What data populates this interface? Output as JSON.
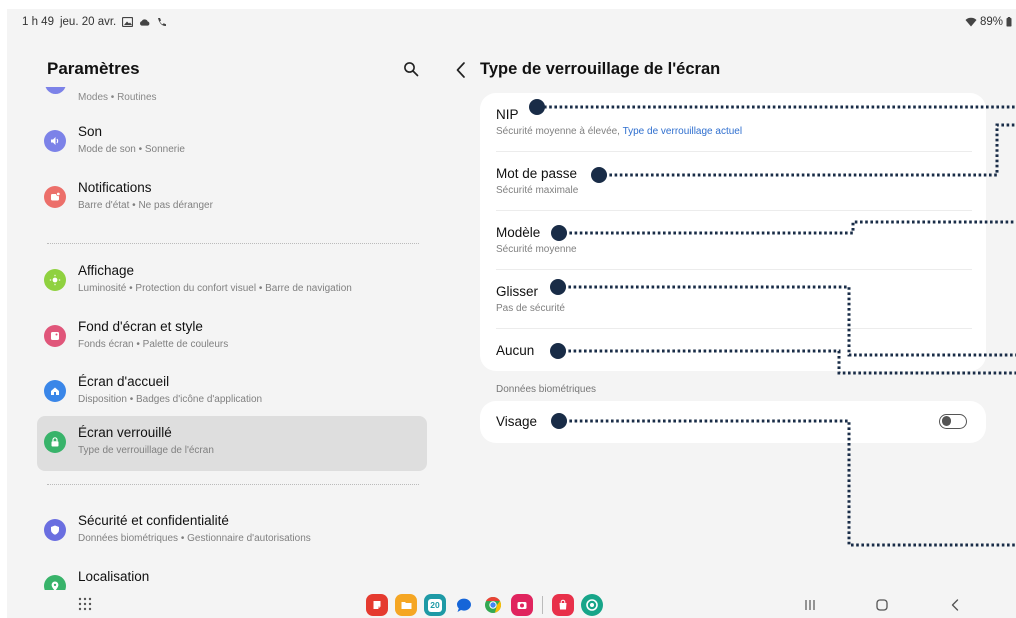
{
  "status_bar": {
    "time": "1 h 49",
    "date": "jeu. 20 avr.",
    "battery": "89%"
  },
  "left_panel": {
    "title": "Paramètres",
    "cut_item_subtitle": "Modes • Routines",
    "items": [
      {
        "title": "Son",
        "subtitle": "Mode de son • Sonnerie",
        "icon": "sound-icon",
        "color": "#7c82e8"
      },
      {
        "title": "Notifications",
        "subtitle": "Barre d'état • Ne pas déranger",
        "icon": "notification-icon",
        "color": "#ec6f6a"
      },
      {
        "title": "Affichage",
        "subtitle": "Luminosité • Protection du confort visuel • Barre de navigation",
        "icon": "display-icon",
        "color": "#8fd13f"
      },
      {
        "title": "Fond d'écran et style",
        "subtitle": "Fonds écran • Palette de couleurs",
        "icon": "wallpaper-icon",
        "color": "#e0567a"
      },
      {
        "title": "Écran d'accueil",
        "subtitle": "Disposition • Badges d'icône d'application",
        "icon": "home-screen-icon",
        "color": "#3a86e8"
      },
      {
        "title": "Écran verrouillé",
        "subtitle": "Type de verrouillage de l'écran",
        "icon": "lock-icon",
        "color": "#38b36a"
      },
      {
        "title": "Sécurité et confidentialité",
        "subtitle": "Données biométriques • Gestionnaire d'autorisations",
        "icon": "shield-icon",
        "color": "#6a6ee0"
      },
      {
        "title": "Localisation",
        "subtitle": "",
        "icon": "location-icon",
        "color": "#38b36a"
      }
    ]
  },
  "right_panel": {
    "title": "Type de verrouillage de l'écran",
    "options": [
      {
        "title": "NIP",
        "subtitle": "Sécurité moyenne à élevée, ",
        "subtitle_link": "Type de verrouillage actuel"
      },
      {
        "title": "Mot de passe",
        "subtitle": "Sécurité maximale"
      },
      {
        "title": "Modèle",
        "subtitle": "Sécurité moyenne"
      },
      {
        "title": "Glisser",
        "subtitle": "Pas de sécurité"
      },
      {
        "title": "Aucun",
        "subtitle": ""
      }
    ],
    "biometrics_label": "Données biométriques",
    "face": {
      "title": "Visage",
      "enabled": false
    }
  },
  "dock": {
    "calendar_day": "20",
    "apps": [
      {
        "icon": "notes-app-icon",
        "color": "#e53a2f"
      },
      {
        "icon": "files-app-icon",
        "color": "#f5a623"
      },
      {
        "icon": "calendar-app-icon",
        "color": "#1e9aa6"
      },
      {
        "icon": "messages-app-icon",
        "color": "#1565d8"
      },
      {
        "icon": "chrome-app-icon",
        "color": "#34a853"
      },
      {
        "icon": "camera-app-icon",
        "color": "#e0245e"
      },
      {
        "icon": "store-app-icon",
        "color": "#e8304a"
      },
      {
        "icon": "fitness-app-icon",
        "color": "#17a589"
      }
    ]
  },
  "colors": {
    "accent_link": "#2f6fcf",
    "callout": "#192c47",
    "selected_bg": "#dedede"
  }
}
